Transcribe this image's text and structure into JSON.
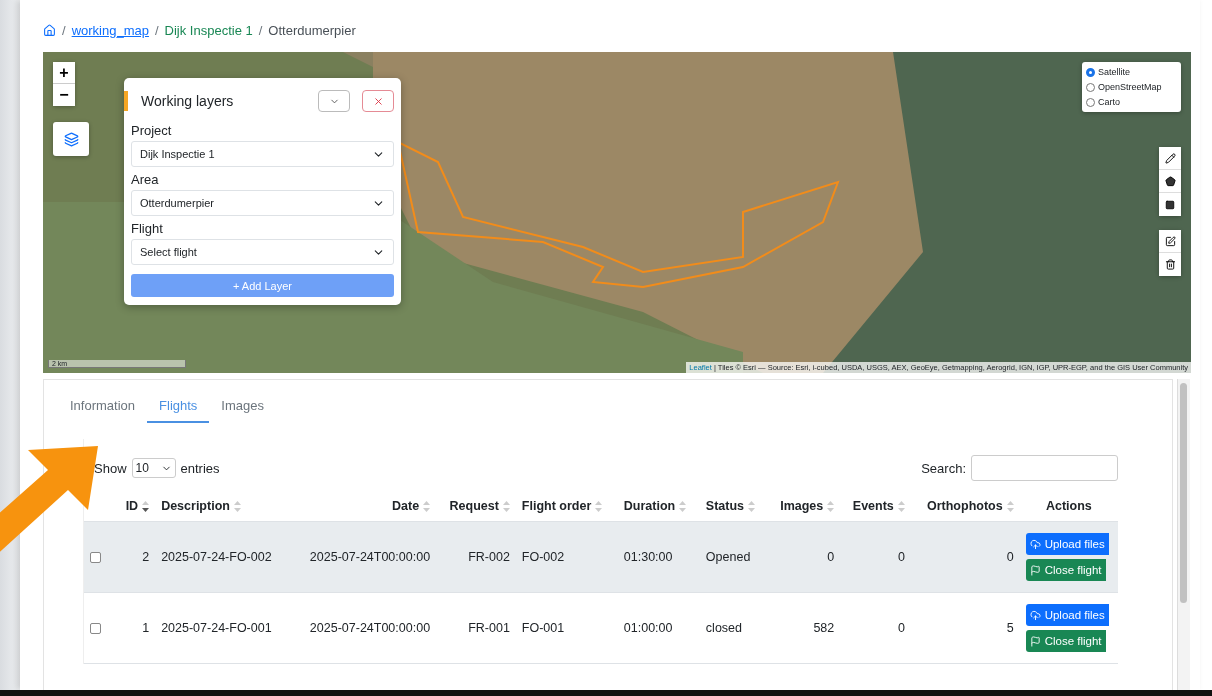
{
  "breadcrumb": [
    {
      "separator": "/",
      "label": "working_map",
      "kind": "link"
    },
    {
      "separator": "/",
      "label": "Dijk Inspectie 1",
      "kind": "green"
    },
    {
      "separator": "/",
      "label": "Otterdumerpier",
      "kind": "plain"
    }
  ],
  "map": {
    "zoom_in": "+",
    "zoom_out": "−",
    "scale": "2 km",
    "attribution_link": "Leaflet",
    "attribution": "| Tiles © Esri — Source: Esri, i-cubed, USDA, USGS, AEX, GeoEye, Getmapping, Aerogrid, IGN, IGP, UPR-EGP, and the GIS User Community",
    "basemaps": [
      {
        "label": "Satellite",
        "selected": true
      },
      {
        "label": "OpenStreetMap",
        "selected": false
      },
      {
        "label": "Carto",
        "selected": false
      }
    ],
    "panel": {
      "title": "Working layers",
      "fields": [
        {
          "label": "Project",
          "value": "Dijk Inspectie 1"
        },
        {
          "label": "Area",
          "value": "Otterdumerpier"
        },
        {
          "label": "Flight",
          "value": "Select flight"
        }
      ],
      "button": "+ Add Layer"
    }
  },
  "tabs": [
    {
      "label": "Information",
      "selected": false
    },
    {
      "label": "Flights",
      "selected": true
    },
    {
      "label": "Images",
      "selected": false
    }
  ],
  "table": {
    "show_label": "Show",
    "entries_value": "10",
    "entries_label": "entries",
    "search_label": "Search:",
    "columns": [
      {
        "label": "ID",
        "sorted": true
      },
      {
        "label": "Description",
        "sorted": false
      },
      {
        "label": "Date",
        "sorted": false
      },
      {
        "label": "Request",
        "sorted": false
      },
      {
        "label": "Flight order",
        "sorted": false
      },
      {
        "label": "Duration",
        "sorted": false
      },
      {
        "label": "Status",
        "sorted": false
      },
      {
        "label": "Images",
        "sorted": false
      },
      {
        "label": "Events",
        "sorted": false
      },
      {
        "label": "Orthophotos",
        "sorted": false
      },
      {
        "label": "Actions"
      }
    ],
    "rows": [
      {
        "checked": false,
        "selected": true,
        "cells": [
          "2",
          "2025-07-24-FO-002",
          "2025-07-24T00:00:00",
          "FR-002",
          "FO-002",
          "01:30:00",
          "Opened",
          "0",
          "0",
          "0"
        ],
        "actions": [
          "Upload files",
          "Close flight"
        ]
      },
      {
        "checked": false,
        "selected": false,
        "cells": [
          "1",
          "2025-07-24-FO-001",
          "2025-07-24T00:00:00",
          "FR-001",
          "FO-001",
          "01:00:00",
          "closed",
          "582",
          "0",
          "5"
        ],
        "actions": [
          "Upload files",
          "Close flight"
        ]
      }
    ]
  }
}
